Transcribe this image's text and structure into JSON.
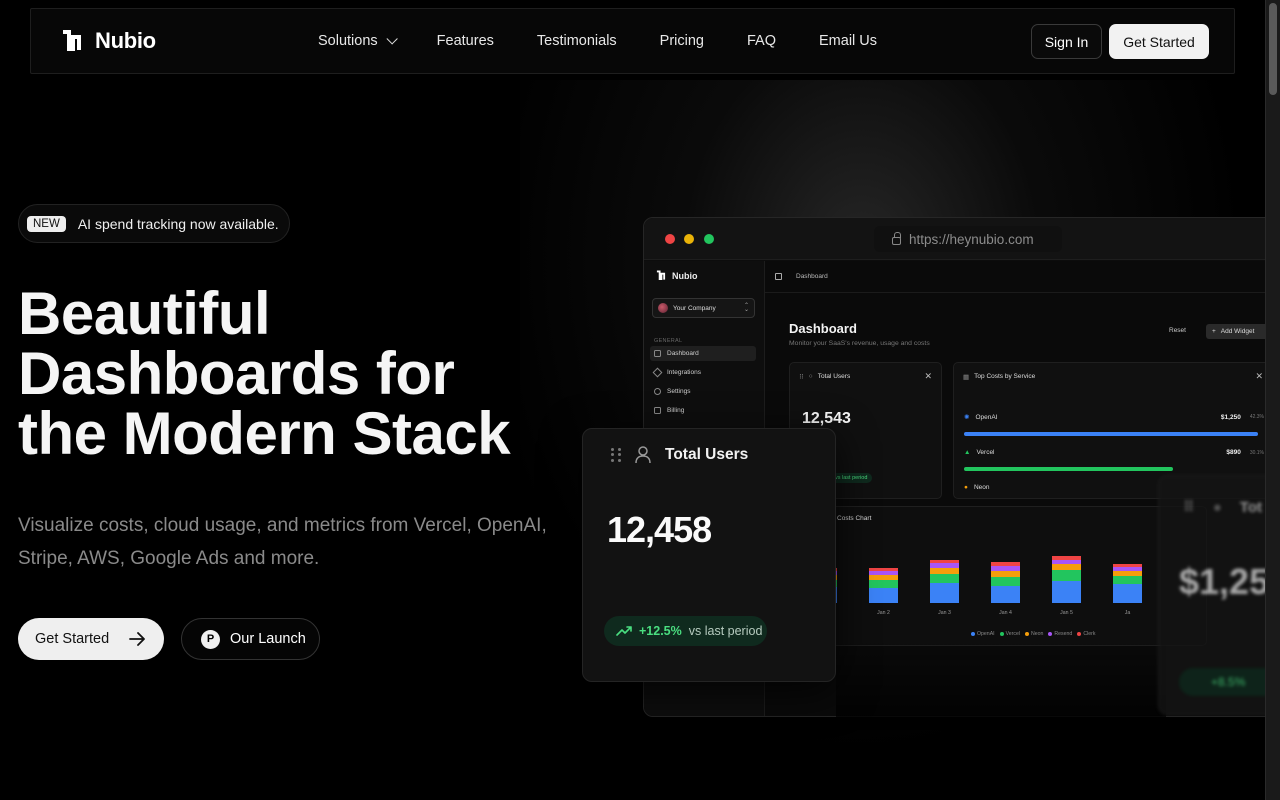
{
  "nav": {
    "brand": "Nubio",
    "menu": [
      "Solutions",
      "Features",
      "Testimonials",
      "Pricing",
      "FAQ",
      "Email Us"
    ],
    "sign_in": "Sign In",
    "get_started": "Get Started"
  },
  "hero": {
    "badge_tag": "NEW",
    "badge_text": "AI spend tracking now available.",
    "title_lines": [
      "Beautiful",
      "Dashboards for",
      "the Modern Stack"
    ],
    "subtitle": "Visualize costs, cloud usage, and metrics from Vercel, OpenAI, Stripe, AWS, Google Ads and more.",
    "cta_primary": "Get Started",
    "cta_secondary": "Our Launch",
    "cta_secondary_icon": "P"
  },
  "browser": {
    "url": "https://heynubio.com",
    "dot_colors": [
      "#ef4444",
      "#eab308",
      "#22c55e"
    ]
  },
  "app": {
    "brand": "Nubio",
    "company": "Your Company",
    "section": "GENERAL",
    "sidebar_items": [
      "Dashboard",
      "Integrations",
      "Settings",
      "Billing"
    ],
    "breadcrumb": "Dashboard",
    "title": "Dashboard",
    "subtitle": "Monitor your SaaS's revenue, usage and costs",
    "reset": "Reset",
    "add_widget": "Add Widget",
    "users_card": {
      "title": "Total Users",
      "value": "12,543",
      "trend": "vs last period"
    },
    "costs_card": {
      "title": "Top Costs by Service",
      "services": [
        {
          "name": "OpenAI",
          "value": "$1,250",
          "pct": "42.3%",
          "color": "#3b82f6",
          "fill": 1.0
        },
        {
          "name": "Vercel",
          "value": "$890",
          "pct": "30.1%",
          "color": "#22c55e",
          "fill": 0.71
        },
        {
          "name": "Neon",
          "value": "",
          "pct": "",
          "color": "#f59e0b",
          "fill": 0
        }
      ]
    },
    "chart": {
      "title": "y Costs Chart",
      "labels": [
        "Jan 1",
        "Jan 2",
        "Jan 3",
        "Jan 4",
        "Jan 5",
        "Ja"
      ],
      "legend": [
        "OpenAI",
        "Vercel",
        "Neon",
        "Resend",
        "Clerk"
      ],
      "legend_colors": [
        "#3b82f6",
        "#22c55e",
        "#f59e0b",
        "#a855f7",
        "#ef4444"
      ]
    }
  },
  "float_users": {
    "title": "Total Users",
    "value": "12,458",
    "trend_value": "+12.5%",
    "trend_text": "vs last period"
  },
  "float_cost": {
    "title": "Tot",
    "value": "$1,25",
    "trend": "+8.5%"
  }
}
